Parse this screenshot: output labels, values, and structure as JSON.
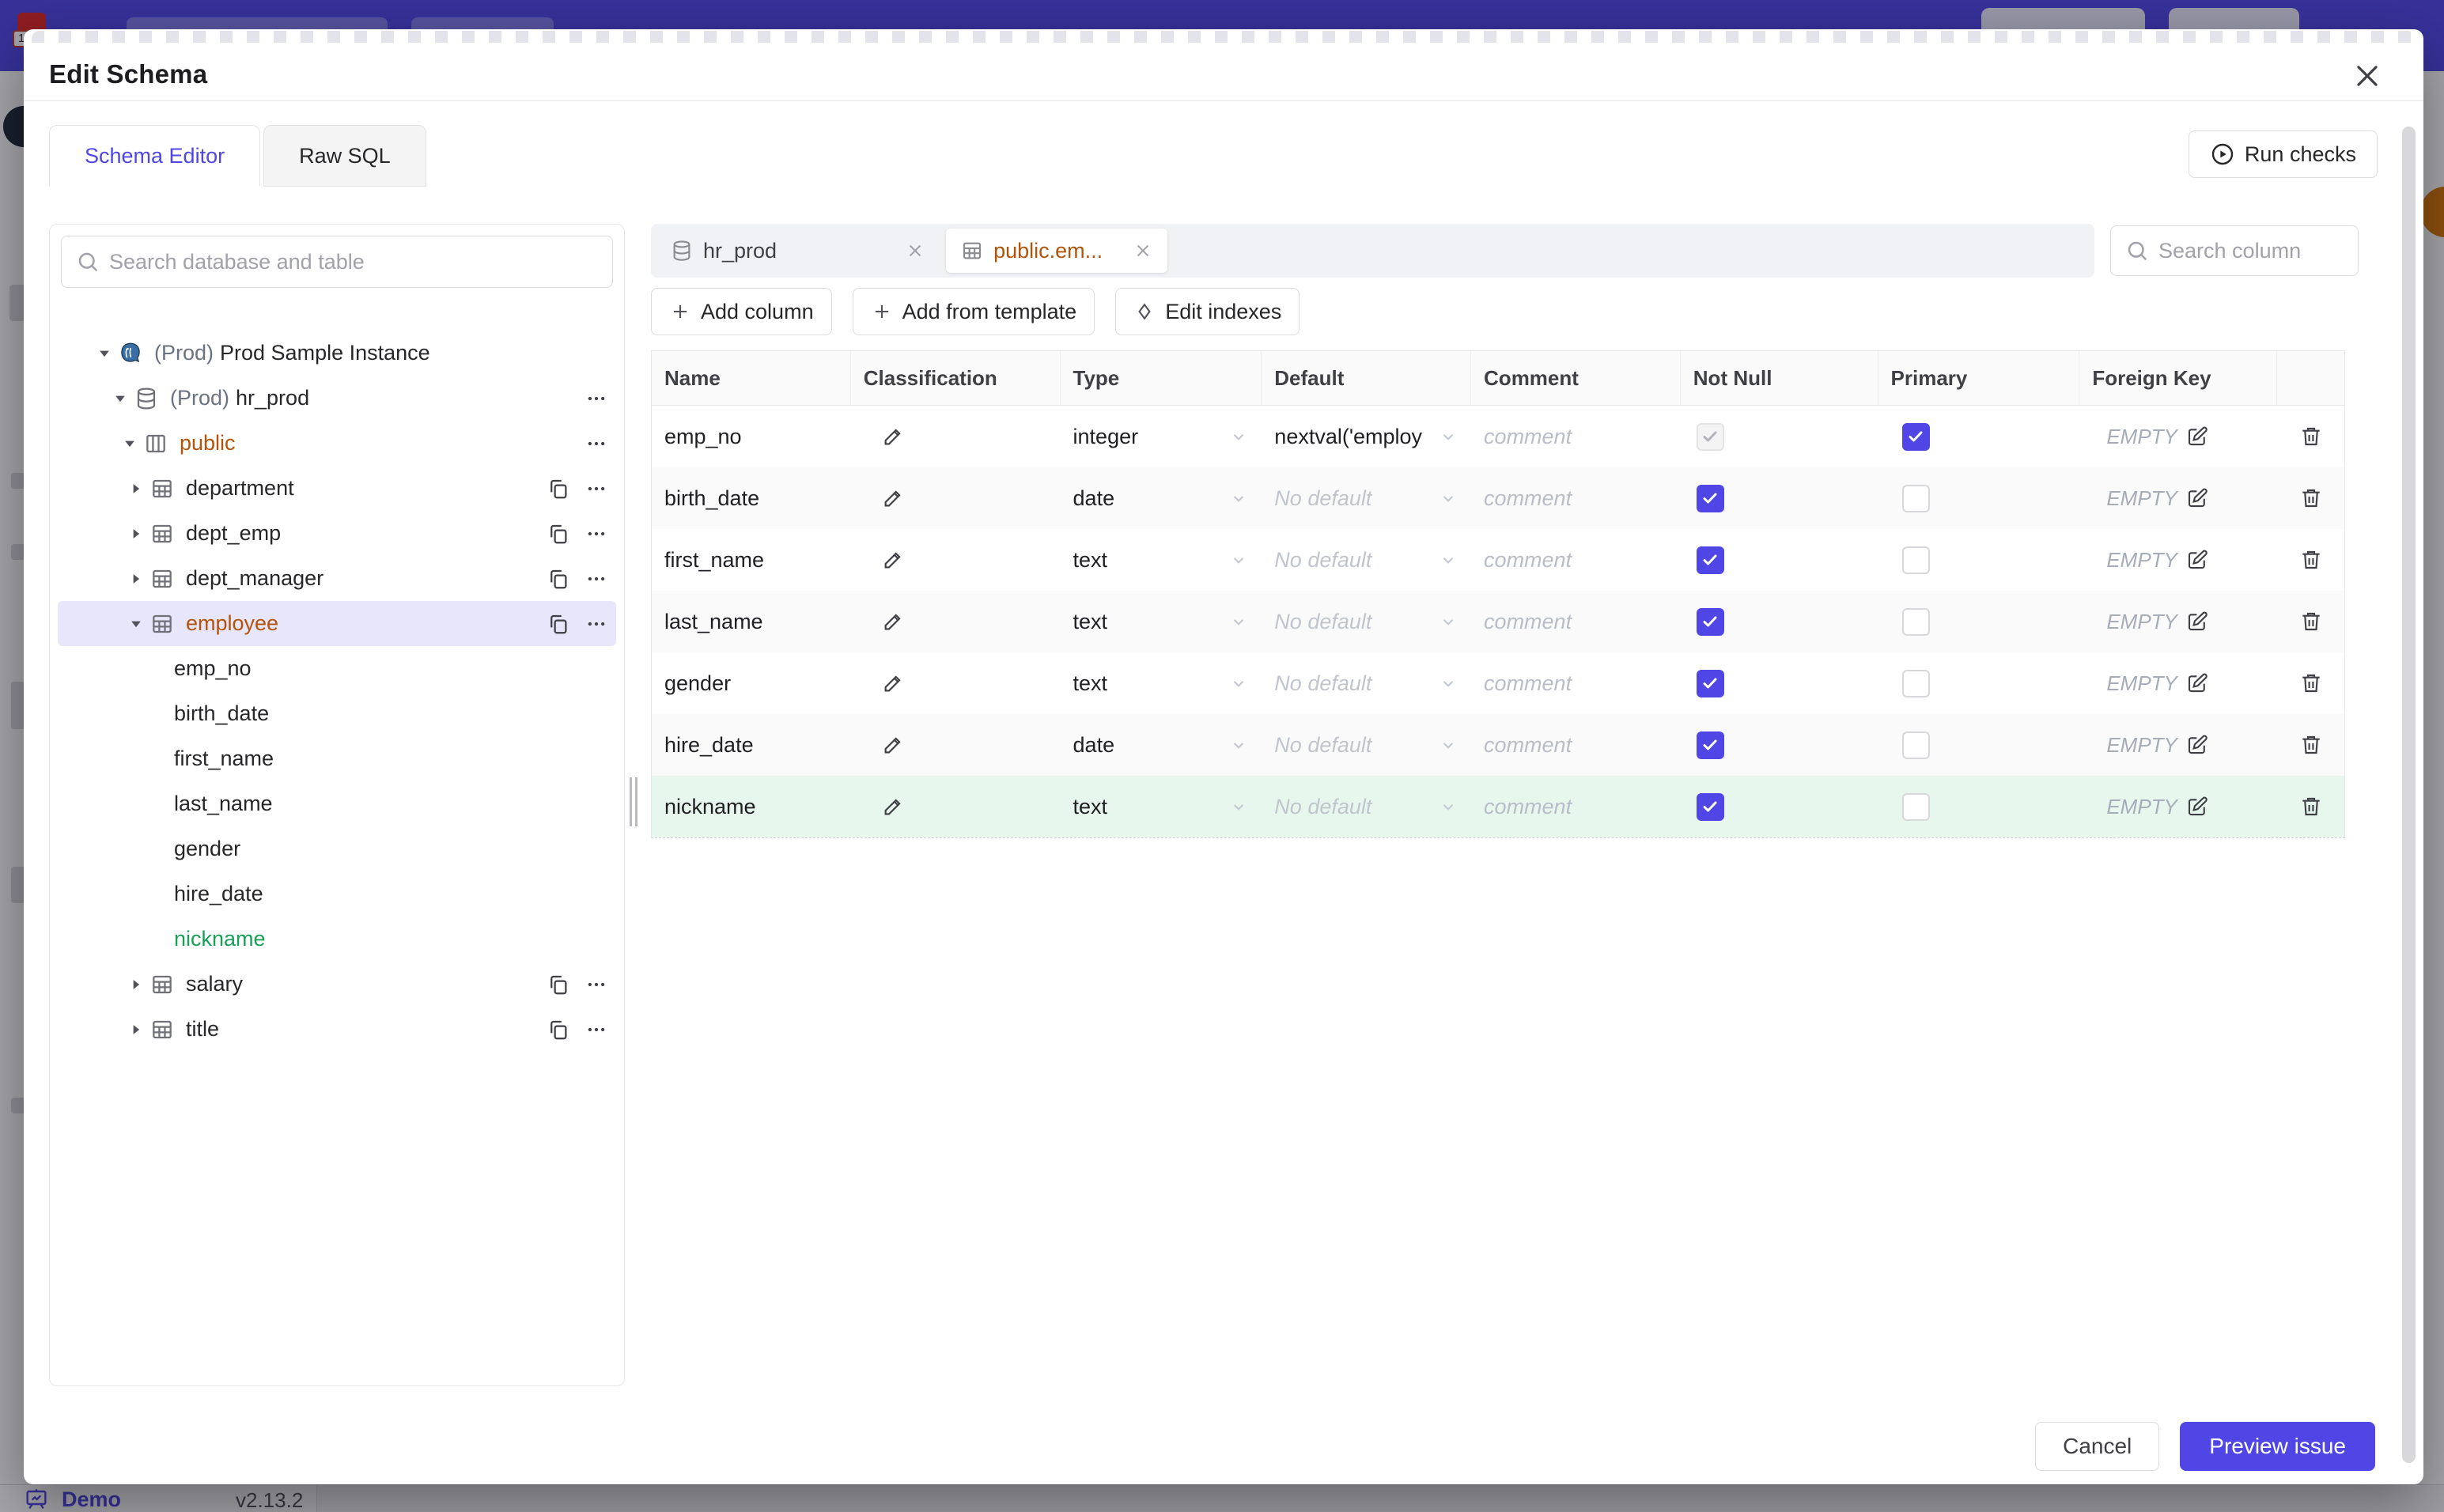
{
  "colors": {
    "accent": "#4f46e5",
    "banner": "#4f46e5",
    "changed_text": "#b45309",
    "new_text": "#18a058",
    "new_row_bg": "#e8f7ee",
    "selected_row_bg": "#e8e6fa",
    "logo_red": "#dc2626",
    "gold_avatar": "#d97706"
  },
  "underlay": {
    "logo_badge": "1",
    "footer": {
      "demo_label": "Demo",
      "version": "v2.13.2"
    }
  },
  "modal": {
    "title": "Edit Schema",
    "tabs": [
      {
        "label": "Schema Editor",
        "active": true
      },
      {
        "label": "Raw SQL",
        "active": false
      }
    ],
    "run_checks_label": "Run checks",
    "sidebar": {
      "search_placeholder": "Search database and table",
      "tree": [
        {
          "level": 0,
          "icon": "postgres",
          "chevron": "down",
          "prefix": "(Prod)",
          "label": "Prod Sample Instance"
        },
        {
          "level": 1,
          "icon": "database",
          "chevron": "down",
          "prefix": "(Prod)",
          "label": "hr_prod",
          "dots": true
        },
        {
          "level": 2,
          "icon": "schema",
          "chevron": "down",
          "label": "public",
          "state": "changed",
          "dots": true
        },
        {
          "level": 3,
          "icon": "table",
          "chevron": "right",
          "label": "department",
          "copy": true,
          "dots": true
        },
        {
          "level": 3,
          "icon": "table",
          "chevron": "right",
          "label": "dept_emp",
          "copy": true,
          "dots": true
        },
        {
          "level": 3,
          "icon": "table",
          "chevron": "right",
          "label": "dept_manager",
          "copy": true,
          "dots": true
        },
        {
          "level": 3,
          "icon": "table",
          "chevron": "down",
          "label": "employee",
          "state": "changed",
          "selected": true,
          "copy": true,
          "dots": true
        },
        {
          "level": 4,
          "label": "emp_no"
        },
        {
          "level": 4,
          "label": "birth_date"
        },
        {
          "level": 4,
          "label": "first_name"
        },
        {
          "level": 4,
          "label": "last_name"
        },
        {
          "level": 4,
          "label": "gender"
        },
        {
          "level": 4,
          "label": "hire_date"
        },
        {
          "level": 4,
          "label": "nickname",
          "state": "new"
        },
        {
          "level": 3,
          "icon": "table",
          "chevron": "right",
          "label": "salary",
          "copy": true,
          "dots": true
        },
        {
          "level": 3,
          "icon": "table",
          "chevron": "right",
          "label": "title",
          "copy": true,
          "dots": true
        }
      ]
    },
    "editor": {
      "chips": [
        {
          "icon": "database",
          "label": "hr_prod",
          "active": false,
          "changed": false
        },
        {
          "icon": "table",
          "label": "public.em...",
          "active": true,
          "changed": true
        }
      ],
      "column_search_placeholder": "Search column",
      "toolbar": [
        {
          "icon": "plus",
          "label": "Add column"
        },
        {
          "icon": "plus",
          "label": "Add from template"
        },
        {
          "icon": "diamond",
          "label": "Edit indexes"
        }
      ],
      "table": {
        "headers": [
          "Name",
          "Classification",
          "Type",
          "Default",
          "Comment",
          "Not Null",
          "Primary",
          "Foreign Key",
          ""
        ],
        "comment_placeholder": "comment",
        "fk_empty_label": "EMPTY",
        "no_default_label": "No default",
        "rows": [
          {
            "name": "emp_no",
            "type": "integer",
            "default": "nextval('employ",
            "default_placeholder": false,
            "not_null": "disabled-checked",
            "primary": "checked",
            "new": false
          },
          {
            "name": "birth_date",
            "type": "date",
            "default": "No default",
            "default_placeholder": true,
            "not_null": "checked",
            "primary": "unchecked",
            "new": false
          },
          {
            "name": "first_name",
            "type": "text",
            "default": "No default",
            "default_placeholder": true,
            "not_null": "checked",
            "primary": "unchecked",
            "new": false
          },
          {
            "name": "last_name",
            "type": "text",
            "default": "No default",
            "default_placeholder": true,
            "not_null": "checked",
            "primary": "unchecked",
            "new": false
          },
          {
            "name": "gender",
            "type": "text",
            "default": "No default",
            "default_placeholder": true,
            "not_null": "checked",
            "primary": "unchecked",
            "new": false
          },
          {
            "name": "hire_date",
            "type": "date",
            "default": "No default",
            "default_placeholder": true,
            "not_null": "checked",
            "primary": "unchecked",
            "new": false
          },
          {
            "name": "nickname",
            "type": "text",
            "default": "No default",
            "default_placeholder": true,
            "not_null": "checked",
            "primary": "unchecked",
            "new": true
          }
        ]
      }
    },
    "footer": {
      "cancel_label": "Cancel",
      "primary_label": "Preview issue"
    }
  }
}
